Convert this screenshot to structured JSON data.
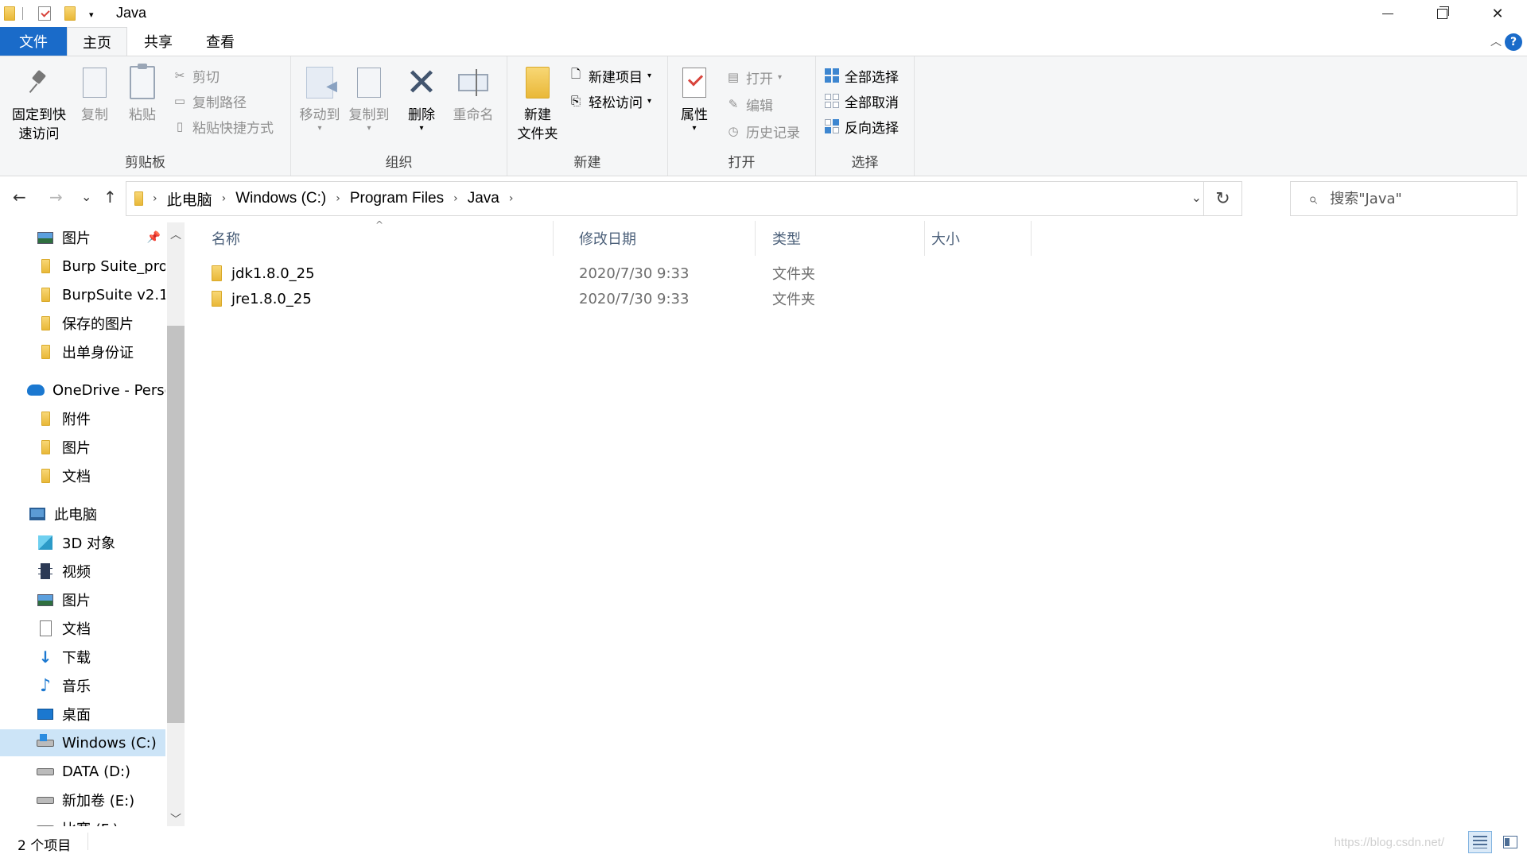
{
  "window": {
    "title": "Java",
    "dropdown_glyph": "▾"
  },
  "window_controls": {
    "minimize_icon": "minimize-icon",
    "restore_icon": "restore-icon",
    "close_glyph": "✕"
  },
  "ribbon_tabs": {
    "file": "文件",
    "home": "主页",
    "share": "共享",
    "view": "查看",
    "collapse_glyph": "︿",
    "help_glyph": "?"
  },
  "ribbon": {
    "clipboard": {
      "label": "剪贴板",
      "pin_line1": "固定到快",
      "pin_line2": "速访问",
      "copy": "复制",
      "paste": "粘贴",
      "cut": "剪切",
      "copy_path": "复制路径",
      "paste_shortcut": "粘贴快捷方式"
    },
    "organize": {
      "label": "组织",
      "move_to": "移动到",
      "copy_to": "复制到",
      "delete": "删除",
      "rename": "重命名"
    },
    "new": {
      "label": "新建",
      "new_folder_line1": "新建",
      "new_folder_line2": "文件夹",
      "new_item": "新建项目",
      "easy_access": "轻松访问"
    },
    "open": {
      "label": "打开",
      "properties": "属性",
      "open": "打开",
      "edit": "编辑",
      "history": "历史记录"
    },
    "select": {
      "label": "选择",
      "select_all": "全部选择",
      "select_none": "全部取消",
      "invert": "反向选择"
    },
    "dropdown_glyph": "▾"
  },
  "navigation": {
    "back_glyph": "←",
    "forward_glyph": "→",
    "recent_glyph": "⌄",
    "up_glyph": "↑",
    "breadcrumbs": [
      "此电脑",
      "Windows (C:)",
      "Program Files",
      "Java"
    ],
    "separator": "›",
    "address_dropdown_glyph": "⌄",
    "refresh_glyph": "↻",
    "search_placeholder": "搜索\"Java\"",
    "search_glyph": "⌕"
  },
  "nav_pane": {
    "pin_glyph": "📌",
    "scroll_up_glyph": "︿",
    "scroll_down_glyph": "﹀",
    "items": [
      {
        "label": "图片",
        "icon": "pictures-icon"
      },
      {
        "label": "Burp Suite_pro_",
        "icon": "folder-icon"
      },
      {
        "label": "BurpSuite v2.1",
        "icon": "folder-icon"
      },
      {
        "label": "保存的图片",
        "icon": "folder-icon"
      },
      {
        "label": "出单身份证",
        "icon": "folder-icon"
      },
      {
        "label": "OneDrive - Perso",
        "icon": "onedrive-icon"
      },
      {
        "label": "附件",
        "icon": "folder-icon"
      },
      {
        "label": "图片",
        "icon": "folder-icon"
      },
      {
        "label": "文档",
        "icon": "folder-icon"
      },
      {
        "label": "此电脑",
        "icon": "this-pc-icon"
      },
      {
        "label": "3D 对象",
        "icon": "3d-objects-icon"
      },
      {
        "label": "视频",
        "icon": "videos-icon"
      },
      {
        "label": "图片",
        "icon": "pictures-icon"
      },
      {
        "label": "文档",
        "icon": "documents-icon"
      },
      {
        "label": "下载",
        "icon": "downloads-icon"
      },
      {
        "label": "音乐",
        "icon": "music-icon"
      },
      {
        "label": "桌面",
        "icon": "desktop-icon"
      },
      {
        "label": "Windows (C:)",
        "icon": "windows-drive-icon"
      },
      {
        "label": "DATA (D:)",
        "icon": "drive-icon"
      },
      {
        "label": "新加卷 (E:)",
        "icon": "drive-icon"
      },
      {
        "label": "比赛 (F:)",
        "icon": "drive-icon"
      }
    ],
    "selected_label": "Windows (C:)"
  },
  "file_list": {
    "columns": [
      "名称",
      "修改日期",
      "类型",
      "大小"
    ],
    "sort_glyph": "^",
    "rows": [
      {
        "name": "jdk1.8.0_25",
        "modified": "2020/7/30 9:33",
        "type": "文件夹",
        "size": ""
      },
      {
        "name": "jre1.8.0_25",
        "modified": "2020/7/30 9:33",
        "type": "文件夹",
        "size": ""
      }
    ]
  },
  "status_bar": {
    "item_count": "2 个项目",
    "watermark": "https://blog.csdn.net/",
    "views": [
      "details-view-icon",
      "large-icons-view-icon"
    ]
  },
  "colors": {
    "accent": "#1a6bc9",
    "selection": "#cce4f7",
    "folder": "#e9b838",
    "ribbon_bg": "#f5f6f7"
  }
}
